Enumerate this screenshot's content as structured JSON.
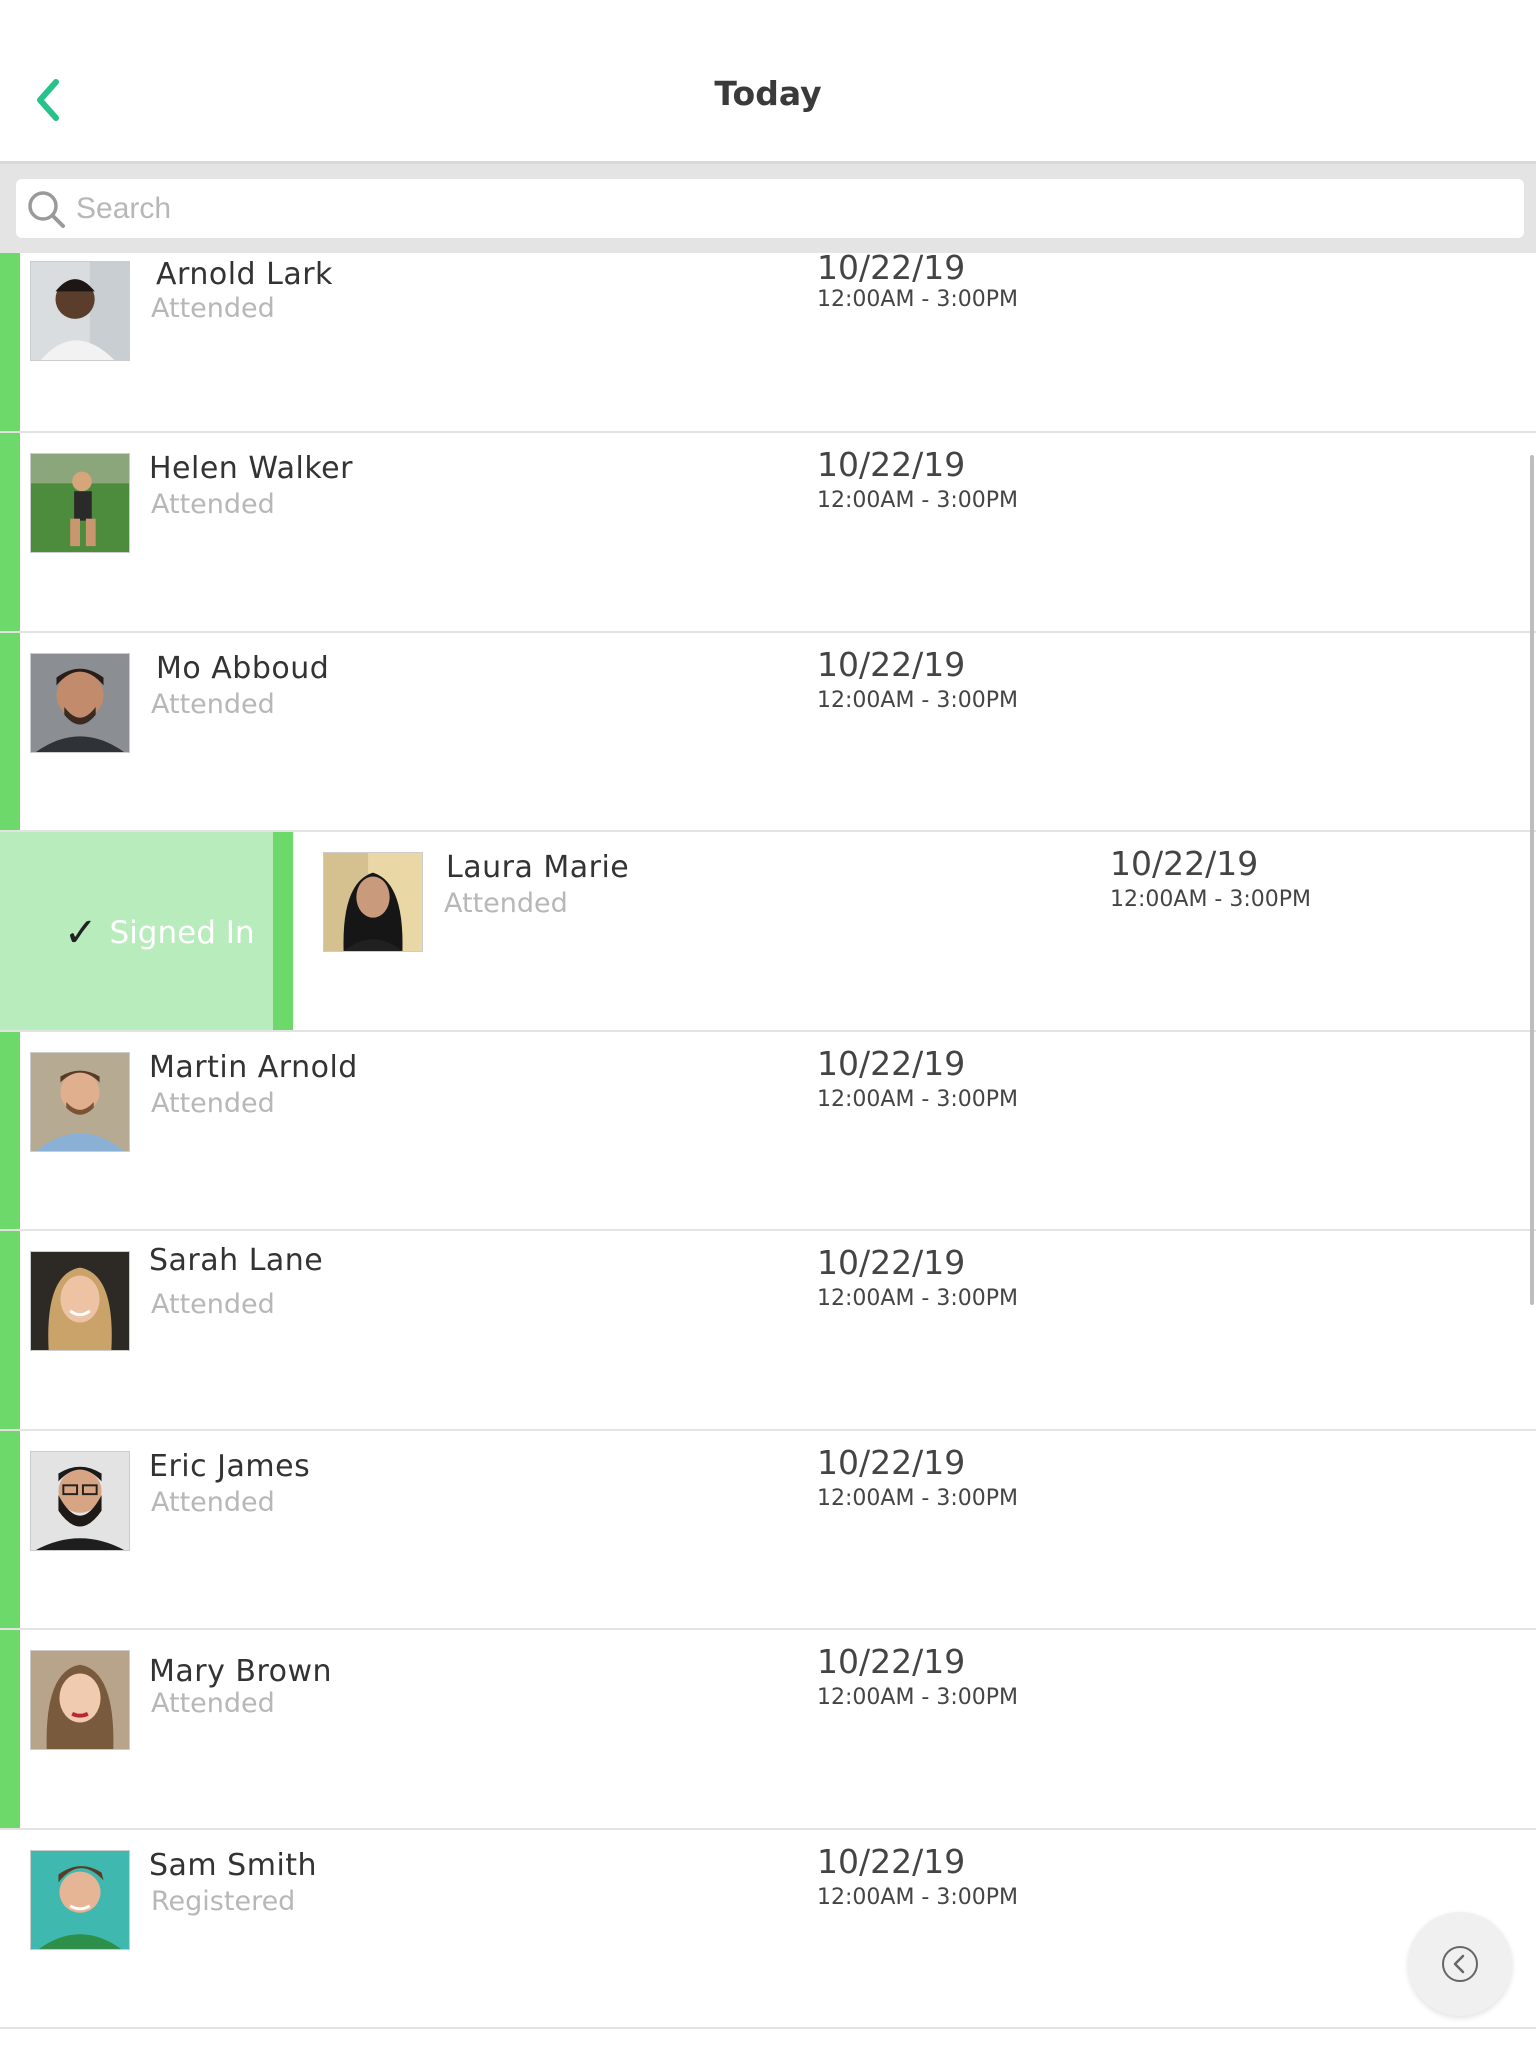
{
  "nav": {
    "title": "Today",
    "back_icon": "chevron-left-icon",
    "accent": "#27c28a"
  },
  "search": {
    "placeholder": "Search",
    "value": "",
    "icon": "search-icon"
  },
  "colors": {
    "stripe": "#6dd96a",
    "signed_bg": "#b8ecbc",
    "status_text": "#b7b7b7"
  },
  "attendees": [
    {
      "name": "Arnold Lark",
      "status": "Attended",
      "date": "10/22/19",
      "time": "12:00AM - 3:00PM"
    },
    {
      "name": "Helen Walker",
      "status": "Attended",
      "date": "10/22/19",
      "time": "12:00AM - 3:00PM"
    },
    {
      "name": "Mo Abboud",
      "status": "Attended",
      "date": "10/22/19",
      "time": "12:00AM - 3:00PM"
    },
    {
      "name": "Laura Marie",
      "status": "Attended",
      "date": "10/22/19",
      "time": "12:00AM - 3:00PM"
    },
    {
      "name": "Martin Arnold",
      "status": "Attended",
      "date": "10/22/19",
      "time": "12:00AM - 3:00PM"
    },
    {
      "name": "Sarah Lane",
      "status": "Attended",
      "date": "10/22/19",
      "time": "12:00AM - 3:00PM"
    },
    {
      "name": "Eric James",
      "status": "Attended",
      "date": "10/22/19",
      "time": "12:00AM - 3:00PM"
    },
    {
      "name": "Mary Brown",
      "status": "Attended",
      "date": "10/22/19",
      "time": "12:00AM - 3:00PM"
    },
    {
      "name": "Sam Smith",
      "status": "Registered",
      "date": "10/22/19",
      "time": "12:00AM - 3:00PM"
    }
  ],
  "swipe_action": {
    "label": "Signed In",
    "icon": "checkmark-icon"
  },
  "fab": {
    "icon": "chevron-left-circle-icon"
  }
}
